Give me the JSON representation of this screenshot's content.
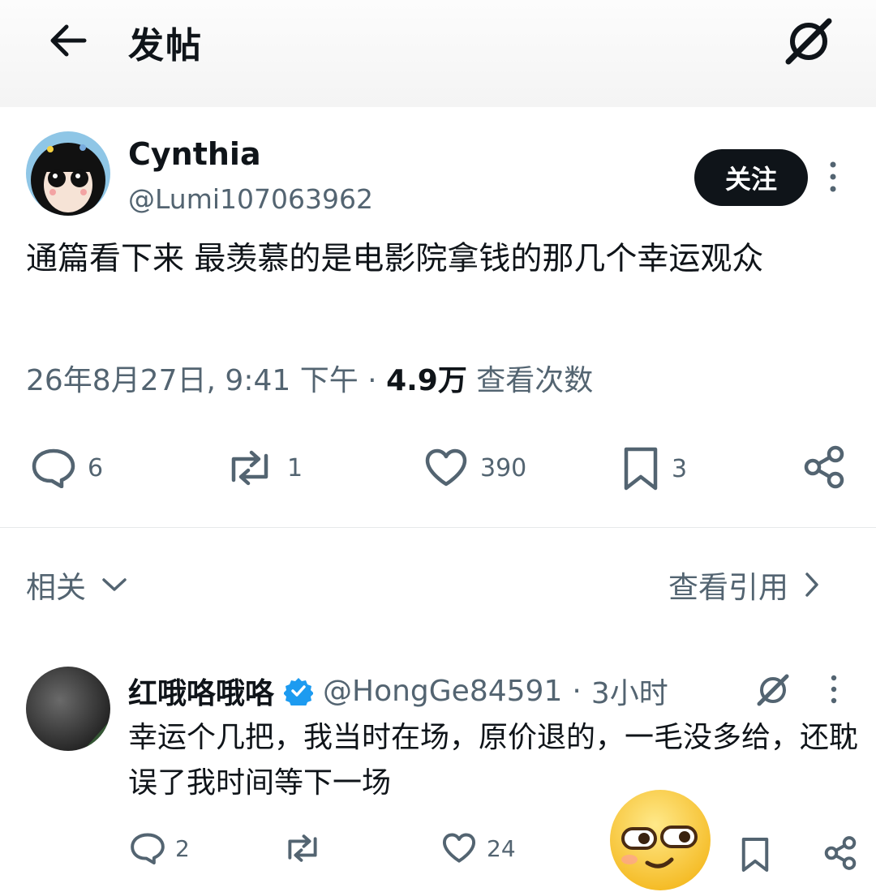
{
  "header": {
    "title": "发帖",
    "back_icon": "arrow-left-icon",
    "grok_icon": "grok-icon"
  },
  "post": {
    "author": {
      "display_name": "Cynthia",
      "handle": "@Lumi107063962"
    },
    "follow_label": "关注",
    "text": "通篇看下来 最羡慕的是电影院拿钱的那几个幸运观众",
    "timestamp": "26年8月27日, 9:41 下午",
    "separator": "·",
    "views": "4.9万",
    "views_label": "查看次数",
    "actions": {
      "replies": "6",
      "reposts": "1",
      "likes": "390",
      "bookmarks": "3"
    }
  },
  "related": {
    "label": "相关",
    "quotes_label": "查看引用"
  },
  "reply": {
    "display_name": "红哦咯哦咯",
    "verified": true,
    "handle": "@HongGe84591",
    "separator": "·",
    "time": "3小时",
    "text": "幸运个几把，我当时在场，原价退的，一毛没多给，还耽误了我时间等下一场",
    "actions": {
      "replies": "2",
      "likes": "24"
    }
  },
  "colors": {
    "text": "#0f1419",
    "muted": "#536471",
    "verified": "#1d9bf0",
    "button": "#0f1419"
  }
}
